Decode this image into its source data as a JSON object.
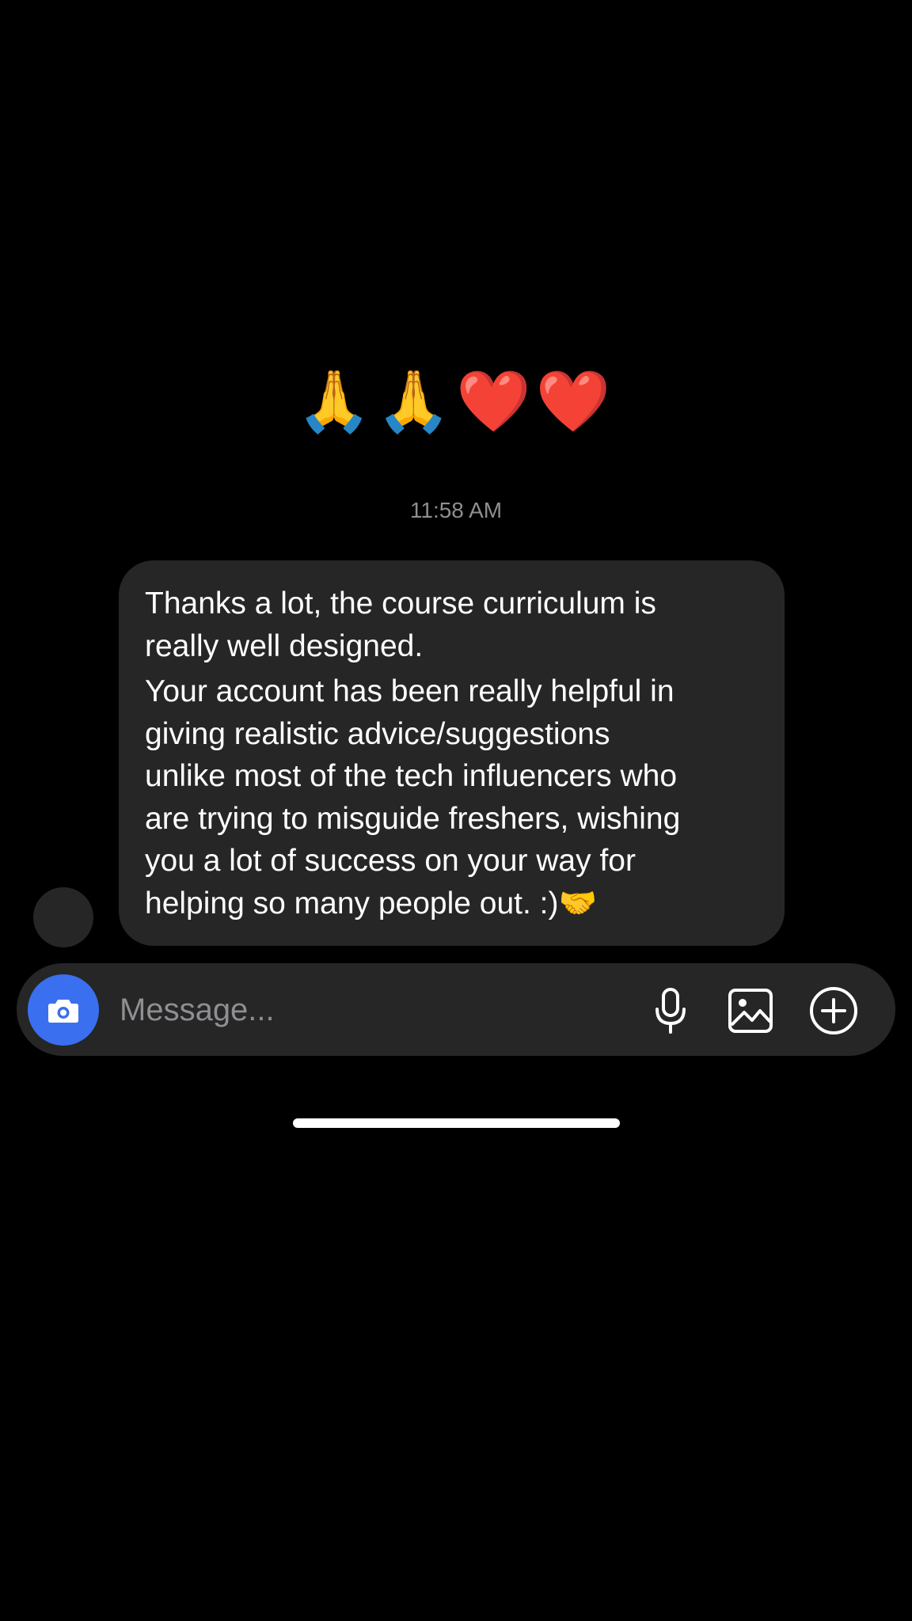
{
  "reactions": {
    "emojis": [
      "🙏",
      "🙏",
      "❤️",
      "❤️"
    ]
  },
  "thread": {
    "timestamp": "11:58 AM",
    "message": {
      "paragraph1": "Thanks a lot, the course curriculum is\nreally well designed.",
      "paragraph2": "Your account has been really helpful in\ngiving realistic advice/suggestions\nunlike most of the tech influencers who\nare trying to misguide freshers, wishing\nyou a lot of success on your way for\nhelping so many people out. :)🤝"
    }
  },
  "composer": {
    "placeholder": "Message...",
    "camera_icon": "camera-icon",
    "mic_icon": "microphone-icon",
    "gallery_icon": "image-icon",
    "more_icon": "plus-circle-icon"
  },
  "colors": {
    "background": "#000000",
    "bubble": "#262626",
    "accent": "#3a6ff0",
    "muted_text": "#8e8e93"
  }
}
